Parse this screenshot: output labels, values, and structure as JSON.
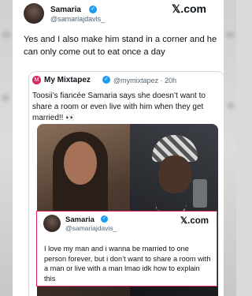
{
  "header": {
    "user_name": "Samaria",
    "user_handle": "@samariajdavis_",
    "brand": "𝕏.com",
    "verified_icon": "verified-badge"
  },
  "tweet": {
    "text": "Yes and I also make him stand in a corner and he can only come out to eat once a day"
  },
  "quoted_tweet": {
    "account_name": "My Mixtapez",
    "account_handle": "@mymixtapez · 20h",
    "logo_icon": "mixtapez-logo",
    "text": "Toosii’s fiancée Samaria says she doesn’t want to share a room or even live with him when they get married!! 👀"
  },
  "embedded_tweet": {
    "user_name": "Samaria",
    "user_handle": "@samariajdavis_",
    "brand": "𝕏.com",
    "text": "I love my man and i wanna be married to one person forever, but i don’t want to share a room with a man or live with a man lmao idk how to explain this"
  },
  "colors": {
    "verified": "#1d9bf0",
    "highlight_border": "#e0245e",
    "text": "#0f1419",
    "muted": "#536471"
  }
}
